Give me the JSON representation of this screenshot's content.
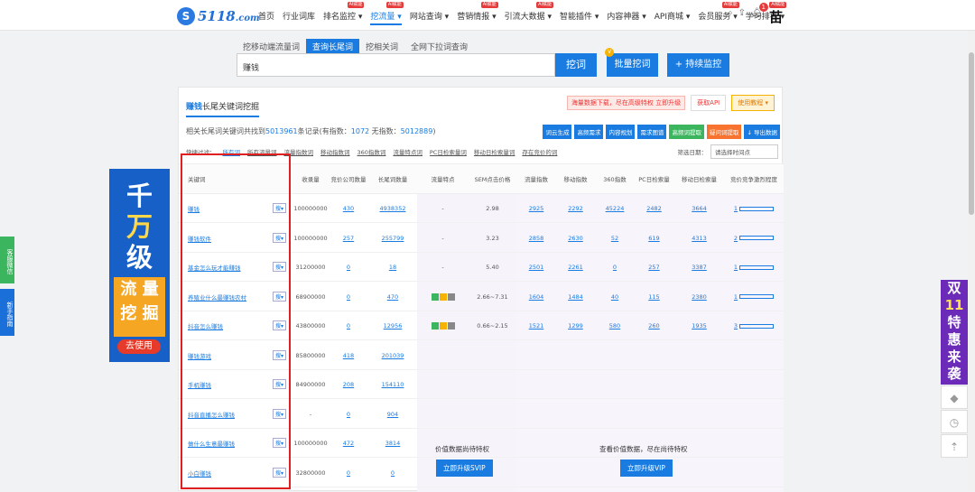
{
  "topbar": {
    "logo_text": "5118",
    "logo_suffix": ".com",
    "nav": [
      {
        "label": "首页",
        "badge": ""
      },
      {
        "label": "行业词库",
        "badge": ""
      },
      {
        "label": "排名监控 ▾",
        "badge": "AI赋能"
      },
      {
        "label": "挖流量 ▾",
        "badge": "AI赋能",
        "active": true
      },
      {
        "label": "网站查询 ▾",
        "badge": ""
      },
      {
        "label": "营销情报 ▾",
        "badge": "AI赋能"
      },
      {
        "label": "引流大数据 ▾",
        "badge": "AI赋能"
      },
      {
        "label": "智能插件 ▾",
        "badge": ""
      },
      {
        "label": "内容神器 ▾",
        "badge": ""
      },
      {
        "label": "API商城 ▾",
        "badge": ""
      },
      {
        "label": "会员服务 ▾",
        "badge": "AI赋能"
      },
      {
        "label": "学习排名 ▾",
        "badge": "AI赋能"
      }
    ],
    "notif_count": "1",
    "avatar_char": "苗"
  },
  "tabs": [
    "挖移动端流量词",
    "查询长尾词",
    "挖相关词",
    "全网下拉词查询"
  ],
  "search": {
    "value": "赚钱",
    "button": "挖词",
    "bulk": "批量挖词",
    "bulk_badge": "V",
    "monitor": "+ 持续监控"
  },
  "panel": {
    "title_kw": "赚钱",
    "title_rest": "长尾关键词挖掘",
    "warn": "海量数据下载，尽在高级特权 立即升级",
    "api": "获取API",
    "tutorial": "使用教程 ▾",
    "summary_pre": "相关长尾词关键词共找到",
    "summary_count": "5013961",
    "summary_mid": "条记录(有指数：",
    "summary_idx": "1072",
    "summary_mid2": " 无指数：",
    "summary_noidx": "5012889",
    "summary_end": ")",
    "actions": [
      "词云生成",
      "高频需求",
      "内容规划",
      "需求图谱",
      "高频词提取",
      "疑问词提取",
      "↓ 导出数据"
    ],
    "filter_label": "快捷过滤：",
    "filters": [
      "所有词",
      "所有流量词",
      "流量指数词",
      "移动指数词",
      "360指数词",
      "流量特点词",
      "PC日检索量词",
      "移动日检索量词",
      "存在竞价的词"
    ],
    "date_label": "筛选日期：",
    "date_value": "请选择时间点",
    "headers": [
      "关键词",
      "收录量",
      "竞价公司数量",
      "长尾词数量",
      "流量特点",
      "SEM点击价格",
      "流量指数",
      "移动指数",
      "360指数",
      "PC日检索量",
      "移动日检索量",
      "竞价竞争激烈程度"
    ],
    "rows": [
      {
        "kw": "赚钱",
        "sl": "100000000",
        "jj": "430",
        "cw": "4938352",
        "tr": "-",
        "sem": "2.98",
        "ll": "2925",
        "yd": "2292",
        "s360": "45224",
        "pc": "2482",
        "mb": "3664",
        "jz": "1"
      },
      {
        "kw": "赚钱软件",
        "sl": "100000000",
        "jj": "257",
        "cw": "255799",
        "tr": "-",
        "sem": "3.23",
        "ll": "2858",
        "yd": "2630",
        "s360": "52",
        "pc": "619",
        "mb": "4313",
        "jz": "2"
      },
      {
        "kw": "基金怎么玩才能赚钱",
        "sl": "31200000",
        "jj": "0",
        "cw": "18",
        "tr": "-",
        "sem": "5.40",
        "ll": "2501",
        "yd": "2261",
        "s360": "0",
        "pc": "257",
        "mb": "3387",
        "jz": "1"
      },
      {
        "kw": "养殖业什么最赚钱农村",
        "sl": "68900000",
        "jj": "0",
        "cw": "470",
        "tr": "tags",
        "sem": "2.66~7.31",
        "ll": "1604",
        "yd": "1484",
        "s360": "40",
        "pc": "115",
        "mb": "2380",
        "jz": "1"
      },
      {
        "kw": "抖音怎么赚钱",
        "sl": "43800000",
        "jj": "0",
        "cw": "12956",
        "tr": "tags",
        "sem": "0.66~2.15",
        "ll": "1521",
        "yd": "1299",
        "s360": "580",
        "pc": "260",
        "mb": "1935",
        "jz": "3"
      },
      {
        "kw": "赚钱游戏",
        "sl": "85800000",
        "jj": "418",
        "cw": "201039"
      },
      {
        "kw": "手机赚钱",
        "sl": "84900000",
        "jj": "208",
        "cw": "154110"
      },
      {
        "kw": "抖音直播怎么赚钱",
        "sl": "-",
        "jj": "0",
        "cw": "904"
      },
      {
        "kw": "做什么生意最赚钱",
        "sl": "100000000",
        "jj": "472",
        "cw": "3814"
      },
      {
        "kw": "小白赚钱",
        "sl": "32800000",
        "jj": "0",
        "cw": "0"
      }
    ],
    "sou_label": "搜▾",
    "vip1_msg": "价值数据尚待特权",
    "vip1_btn": "立即升级SVIP",
    "vip2_msg": "查看价值数据，尽在尚待特权",
    "vip2_btn": "立即升级VIP"
  },
  "ads": {
    "left_l1": "千",
    "left_l2": "万",
    "left_l3": "级",
    "left_c1": "流 量",
    "left_c2": "挖 掘",
    "left_go": "去使用",
    "side_wechat": "客服微信",
    "side_guide": "新手指南",
    "right": [
      "双",
      "11",
      "特",
      "惠",
      "来",
      "袭"
    ]
  },
  "colors": {
    "accent": "#1a7ce0",
    "highlight": "#e02020"
  }
}
